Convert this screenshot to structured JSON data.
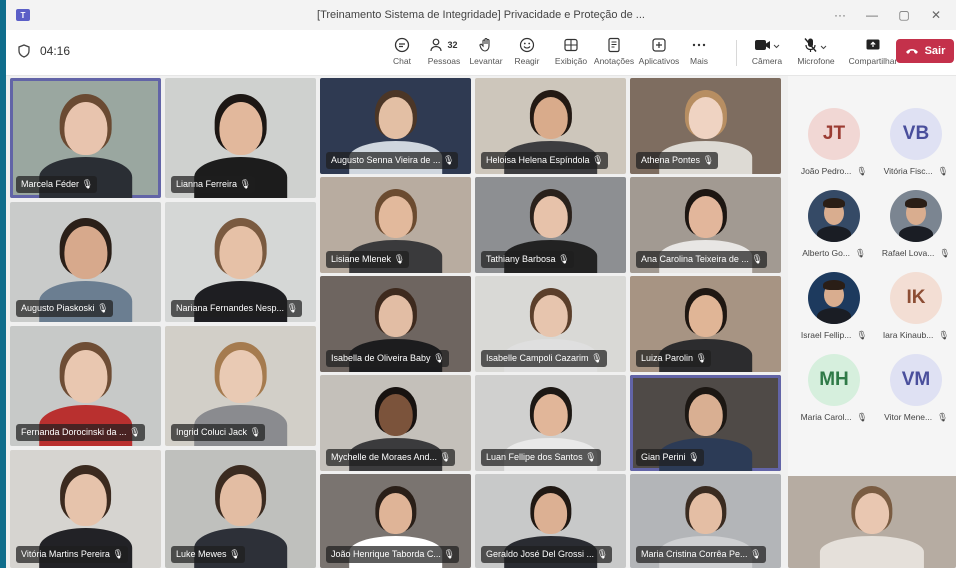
{
  "window": {
    "app_icon": "teams-icon",
    "title": "[Treinamento Sistema de Integridade] Privacidade e Proteção de ...",
    "controls": [
      "···",
      "—",
      "▢",
      "✕"
    ]
  },
  "toolbar": {
    "timer": "04:16",
    "buttons": [
      {
        "key": "chat",
        "label": "Chat",
        "icon": "chat-icon"
      },
      {
        "key": "people",
        "label": "Pessoas",
        "icon": "people-icon",
        "count": "32"
      },
      {
        "key": "raise",
        "label": "Levantar",
        "icon": "raise-hand-icon"
      },
      {
        "key": "react",
        "label": "Reagir",
        "icon": "smiley-icon"
      },
      {
        "key": "view",
        "label": "Exibição",
        "icon": "grid-icon"
      },
      {
        "key": "notes",
        "label": "Anotações",
        "icon": "notes-icon"
      },
      {
        "key": "apps",
        "label": "Aplicativos",
        "icon": "plus-box-icon"
      },
      {
        "key": "more",
        "label": "Mais",
        "icon": "ellipsis-icon"
      },
      {
        "key": "camera",
        "label": "Câmera",
        "icon": "camera-icon"
      },
      {
        "key": "mic",
        "label": "Microfone",
        "icon": "mic-muted-icon"
      },
      {
        "key": "share",
        "label": "Compartilhar",
        "icon": "share-icon"
      }
    ],
    "leave_label": "Sair"
  },
  "tiles": [
    {
      "name": "Marcela Féder",
      "speaking": true,
      "bg": "#9aa7a0",
      "skin": "#e8c4ae",
      "hair": "#6a4a32",
      "shirt": "#2a2e34"
    },
    {
      "name": "Lianna Ferreira",
      "bg": "#cfd1cf",
      "skin": "#e2b89c",
      "hair": "#1d1714",
      "shirt": "#1c1c1c"
    },
    {
      "name": "Augusto Senna Vieira de ...",
      "bg": "#2f3a52",
      "skin": "#e3bfa4",
      "hair": "#4b3627",
      "shirt": "#cfd6de"
    },
    {
      "name": "Heloisa Helena Espíndola",
      "bg": "#cdc6bb",
      "skin": "#d9ab8b",
      "hair": "#231913",
      "shirt": "#3d3d40"
    },
    {
      "name": "Athena Pontes",
      "bg": "#7e6d60",
      "skin": "#efd3c2",
      "hair": "#b78e62",
      "shirt": "#dddad4"
    },
    {
      "name": "Augusto Piaskoski",
      "bg": "#c9cbca",
      "skin": "#d7a98c",
      "hair": "#2a1f18",
      "shirt": "#6b7e91"
    },
    {
      "name": "Nariana Fernandes Nesp...",
      "bg": "#d5d7d6",
      "skin": "#e6c1a7",
      "hair": "#7a5a40",
      "shirt": "#1e1e22"
    },
    {
      "name": "Lisiane Mlenek",
      "bg": "#b8aca0",
      "skin": "#e2b99c",
      "hair": "#6b4b30",
      "shirt": "#3a3a3c"
    },
    {
      "name": "Tathiany Barbosa",
      "bg": "#8d8f92",
      "skin": "#e7c2aa",
      "hair": "#2a211b",
      "shirt": "#222"
    },
    {
      "name": "Ana Carolina Teixeira de ...",
      "bg": "#a29a92",
      "skin": "#e2b69b",
      "hair": "#1d1612",
      "shirt": "#e8e6e4"
    },
    {
      "name": "Isabella de Oliveira Baby",
      "bg": "#6e6560",
      "skin": "#e2bda4",
      "hair": "#3e2a1e",
      "shirt": "#1c1c1e"
    },
    {
      "name": "Isabelle Campoli Cazarim",
      "bg": "#d9d9d6",
      "skin": "#e7c5ae",
      "hair": "#5b3f2b",
      "shirt": "#dfdfdf"
    },
    {
      "name": "Luiza Parolin",
      "bg": "#a79483",
      "skin": "#e0b596",
      "hair": "#1f1712",
      "shirt": "#2c2c2e"
    },
    {
      "name": "Fernanda Dorocinski da ...",
      "bg": "#c7c9c8",
      "skin": "#e9c7b0",
      "hair": "#6e4d35",
      "shirt": "#b9302f"
    },
    {
      "name": "Ingrid Coluci Jack",
      "bg": "#d2cfc8",
      "skin": "#e9cab4",
      "hair": "#a57b4f",
      "shirt": "#8a8b8f"
    },
    {
      "name": "Mychelle de Moraes And...",
      "bg": "#c4c0ba",
      "skin": "#7b533b",
      "hair": "#171210",
      "shirt": "#3b3b3d"
    },
    {
      "name": "Luan Fellipe dos Santos",
      "bg": "#d0d0cf",
      "skin": "#e1b699",
      "hair": "#1d1814",
      "shirt": "#e9e9e9"
    },
    {
      "name": "Gian Perini",
      "speaking": true,
      "bg": "#4f4a47",
      "skin": "#d9af92",
      "hair": "#1c1713",
      "shirt": "#2c3b56"
    },
    {
      "name": "Vitória Martins Pereira",
      "bg": "#d6d4d0",
      "skin": "#e6c3ab",
      "hair": "#3b2a1f",
      "shirt": "#222226"
    },
    {
      "name": "Luke Mewes",
      "bg": "#bfc0bd",
      "skin": "#e3bda3",
      "hair": "#3b2b20",
      "shirt": "#2d3038"
    },
    {
      "name": "João Henrique Taborda C...",
      "bg": "#7a7470",
      "skin": "#dfb497",
      "hair": "#2a1f18",
      "shirt": "#ffffff"
    },
    {
      "name": "Geraldo José Del Grossi ...",
      "bg": "#c8c9c9",
      "skin": "#dcb093",
      "hair": "#201813",
      "shirt": "#2a2c32"
    },
    {
      "name": "Maria Cristina Corrêa Pe...",
      "bg": "#b3b5b8",
      "skin": "#e4bea4",
      "hair": "#3a2b20",
      "shirt": "#cfd0d2"
    },
    {
      "name": "",
      "bg": "#b6aca2",
      "skin": "#e9c7b1",
      "hair": "#7a5c42",
      "shirt": "#e5e0da"
    }
  ],
  "side": [
    {
      "name": "João Pedro...",
      "initials": "JT",
      "bg": "#f1d7d4",
      "fg": "#9b3b32"
    },
    {
      "name": "Vitória Fisc...",
      "initials": "VB",
      "bg": "#dfe1f3",
      "fg": "#4a4f9c"
    },
    {
      "name": "Alberto Go...",
      "initials": "",
      "bg": "#354a66",
      "fg": "#fff",
      "photo": true
    },
    {
      "name": "Rafael Lova...",
      "initials": "",
      "bg": "#7b8591",
      "fg": "#fff",
      "photo": true
    },
    {
      "name": "Israel Fellip...",
      "initials": "",
      "bg": "#1d3a5e",
      "fg": "#fff",
      "photo": true
    },
    {
      "name": "Iara Kinaub...",
      "initials": "IK",
      "bg": "#f3ded4",
      "fg": "#8d4e35"
    },
    {
      "name": "Maria Carol...",
      "initials": "MH",
      "bg": "#d6efdd",
      "fg": "#2f7a47"
    },
    {
      "name": "Vitor Mene...",
      "initials": "VM",
      "bg": "#dfe1f3",
      "fg": "#4a4f9c"
    }
  ]
}
